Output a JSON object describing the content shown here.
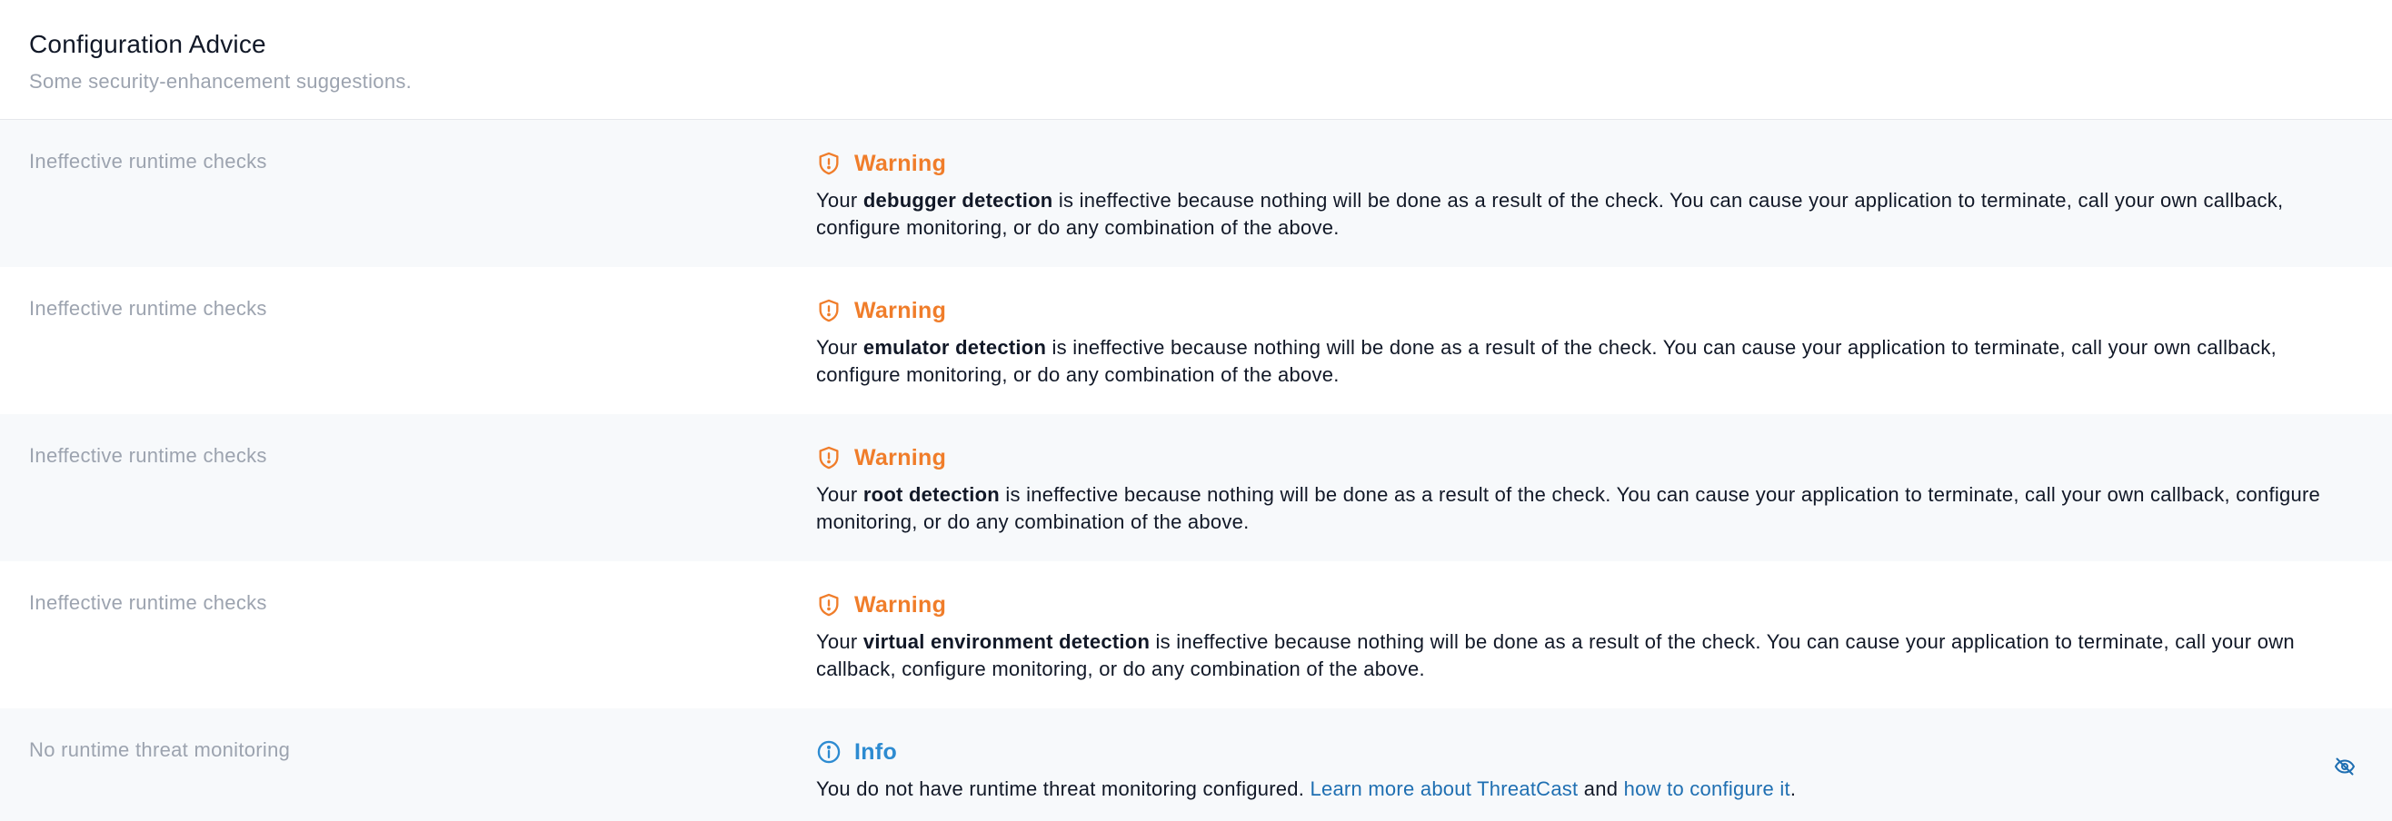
{
  "header": {
    "title": "Configuration Advice",
    "subtitle": "Some security-enhancement suggestions."
  },
  "colors": {
    "warning": "#f07d2a",
    "info": "#2d8bd1",
    "link": "#1f6fb2",
    "muted": "#9ca3af",
    "row_shade": "#f7f9fb"
  },
  "advice": [
    {
      "category": "Ineffective runtime checks",
      "level": "Warning",
      "icon": "shield-warning-icon",
      "prefix": "Your ",
      "bold": "debugger detection",
      "suffix": " is ineffective because nothing will be done as a result of the check. You can cause your application to terminate, call your own callback, configure monitoring, or do any combination of the above."
    },
    {
      "category": "Ineffective runtime checks",
      "level": "Warning",
      "icon": "shield-warning-icon",
      "prefix": "Your ",
      "bold": "emulator detection",
      "suffix": " is ineffective because nothing will be done as a result of the check. You can cause your application to terminate, call your own callback, configure monitoring, or do any combination of the above."
    },
    {
      "category": "Ineffective runtime checks",
      "level": "Warning",
      "icon": "shield-warning-icon",
      "prefix": "Your ",
      "bold": "root detection",
      "suffix": " is ineffective because nothing will be done as a result of the check. You can cause your application to terminate, call your own callback, configure monitoring, or do any combination of the above."
    },
    {
      "category": "Ineffective runtime checks",
      "level": "Warning",
      "icon": "shield-warning-icon",
      "prefix": "Your ",
      "bold": "virtual environment detection",
      "suffix": " is ineffective because nothing will be done as a result of the check. You can cause your application to terminate, call your own callback, configure monitoring, or do any combination of the above."
    },
    {
      "category": "No runtime threat monitoring",
      "level": "Info",
      "icon": "info-circle-icon",
      "text": "You do not have runtime threat monitoring configured. ",
      "link1": "Learn more about ThreatCast",
      "middle": " and ",
      "link2": "how to configure it",
      "end": ".",
      "action_icon": "eye-off-icon"
    }
  ]
}
